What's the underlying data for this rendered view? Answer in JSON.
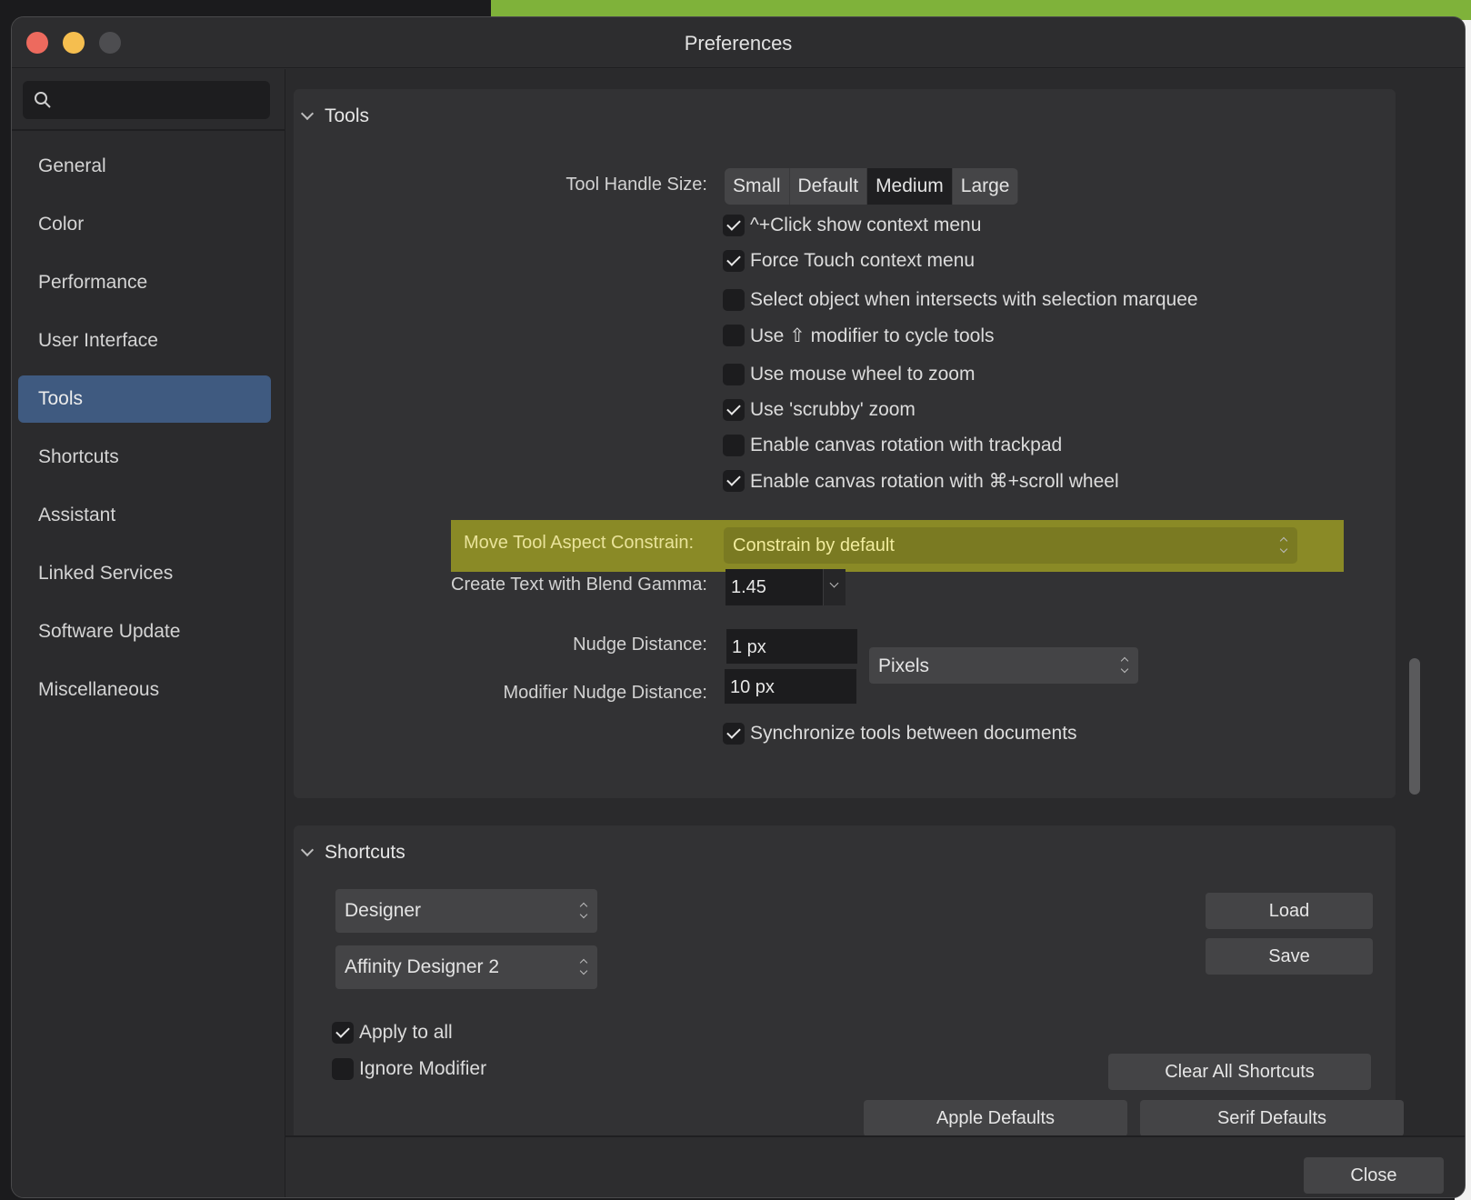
{
  "window": {
    "title": "Preferences"
  },
  "sidebar": {
    "search_placeholder": "",
    "items": [
      {
        "label": "General"
      },
      {
        "label": "Color"
      },
      {
        "label": "Performance"
      },
      {
        "label": "User Interface"
      },
      {
        "label": "Tools",
        "active": true
      },
      {
        "label": "Shortcuts"
      },
      {
        "label": "Assistant"
      },
      {
        "label": "Linked Services"
      },
      {
        "label": "Software Update"
      },
      {
        "label": "Miscellaneous"
      }
    ]
  },
  "tools": {
    "header": "Tools",
    "handle_size": {
      "label": "Tool Handle Size:",
      "options": [
        "Small",
        "Default",
        "Medium",
        "Large"
      ],
      "selected": "Medium"
    },
    "checkboxes": [
      {
        "label": "^+Click show context menu",
        "checked": true
      },
      {
        "label": "Force Touch context menu",
        "checked": true
      },
      {
        "label": "Select object when intersects with selection marquee",
        "checked": false
      },
      {
        "label": "Use ⇧ modifier to cycle tools",
        "checked": false
      },
      {
        "label": "Use mouse wheel to zoom",
        "checked": false
      },
      {
        "label": "Use 'scrubby' zoom",
        "checked": true
      },
      {
        "label": "Enable canvas rotation with trackpad",
        "checked": false
      },
      {
        "label": "Enable canvas rotation with ⌘+scroll wheel",
        "checked": true
      }
    ],
    "aspect_constrain": {
      "label": "Move Tool Aspect Constrain:",
      "value": "Constrain by default"
    },
    "blend_gamma": {
      "label": "Create Text with Blend Gamma:",
      "value": "1.45"
    },
    "nudge": {
      "label": "Nudge Distance:",
      "value": "1 px"
    },
    "modifier_nudge": {
      "label": "Modifier Nudge Distance:",
      "value": "10 px"
    },
    "units": {
      "value": "Pixels"
    },
    "sync": {
      "label": "Synchronize tools between documents",
      "checked": true
    }
  },
  "shortcuts": {
    "header": "Shortcuts",
    "app_select": "Designer",
    "set_select": "Affinity Designer 2",
    "load_label": "Load",
    "save_label": "Save",
    "apply_all": {
      "label": "Apply to all",
      "checked": true
    },
    "ignore_modifier": {
      "label": "Ignore Modifier",
      "checked": false
    },
    "clear_label": "Clear All Shortcuts",
    "apple_defaults_label": "Apple Defaults",
    "serif_defaults_label": "Serif Defaults"
  },
  "footer": {
    "close_label": "Close"
  }
}
